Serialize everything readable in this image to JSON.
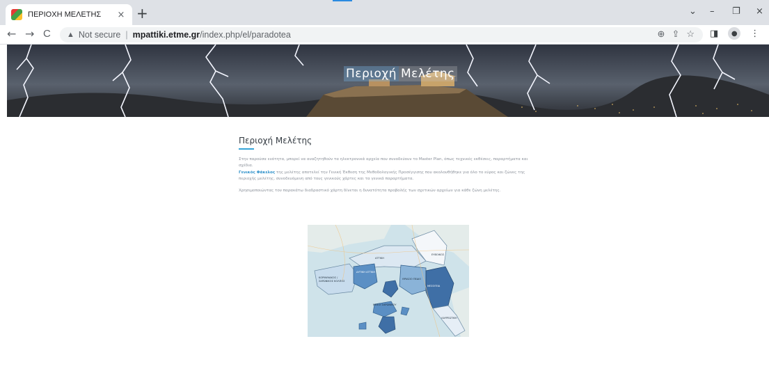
{
  "browser": {
    "tab_title": "ΠΕΡΙΟΧΗ ΜΕΛΕΤΗΣ",
    "tab_close": "×",
    "new_tab": "+",
    "security_label": "Not secure",
    "url_host": "mpattiki.etme.gr",
    "url_path": "/index.php/el/paradotea",
    "nav": {
      "back": "←",
      "forward": "→",
      "reload": "C"
    },
    "window": {
      "dropdown": "⌄",
      "minimize": "–",
      "restore": "❐",
      "close": "×"
    }
  },
  "hero": {
    "title_part1": "Περιοχή",
    "title_part2": "Μελέτης"
  },
  "content": {
    "heading": "Περιοχή Μελέτης",
    "p1": "Στην παρούσα ενότητα, μπορεί να αναζητηθούν τα ηλεκτρονικά αρχεία που συνοδεύουν το Master Plan, όπως τεχνικές εκθέσεις, παραρτήματα και σχέδια.",
    "p2_link": "Γενικός Φάκελος",
    "p2_rest": " της μελέτης αποτελεί την Γενική Έκθεση της Μεθοδολογικής Προσέγγισης που ακολουθήθηκε για όλο το εύρος και ζώνες της περιοχής μελέτης, συνοδευόμενη από τους γενικούς χάρτες και τα γενικά παραρτήματα.",
    "p3": "Χρησιμοποιώντας τον παρακάτω διαδραστικό χάρτη δίνεται η δυνατότητα προβολής των σχετικών αρχείων για κάθε ζώνη μελέτης."
  },
  "map": {
    "labels": {
      "evvoikos": "ΕΥΒΟΙΚΟΣ",
      "attiki": "ΑΤΤΙΚΗ",
      "dytiki": "ΔΥΤΙΚΗ ΑΤΤΙΚΗ",
      "korinthiakos": "ΚΟΡΙΝΘΙΑΚΟΣ / ΣΑΡΩΝΙΚΟΣ ΚΟΛΠΟΣ",
      "thriasio": "ΘΡΙΑΣΙΟ ΠΕΔΙΟ",
      "athina": "ΑΘΗΝΑ",
      "mesogeia": "ΜΕΣΟΓΕΙΑ",
      "saronikos": "ΝΗΣΟΙ ΣΑΡΩΝΙΚΟΥ",
      "lavreotiki": "ΛΑΥΡΕΩΤΙΚΗ"
    }
  }
}
